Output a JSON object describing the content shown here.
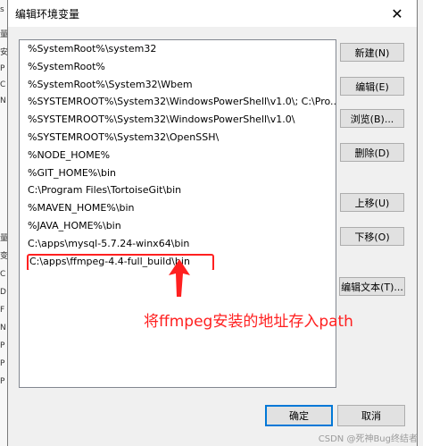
{
  "dialog": {
    "title": "编辑环境变量",
    "close_icon": "close-icon"
  },
  "path_list": {
    "items": [
      "%SystemRoot%\\system32",
      "%SystemRoot%",
      "%SystemRoot%\\System32\\Wbem",
      "%SYSTEMROOT%\\System32\\WindowsPowerShell\\v1.0\\;  C:\\Pro...",
      "%SYSTEMROOT%\\System32\\WindowsPowerShell\\v1.0\\",
      "%SYSTEMROOT%\\System32\\OpenSSH\\",
      "%NODE_HOME%",
      "%GIT_HOME%\\bin",
      "C:\\Program Files\\TortoiseGit\\bin",
      "%MAVEN_HOME%\\bin",
      "%JAVA_HOME%\\bin",
      "C:\\apps\\mysql-5.7.24-winx64\\bin",
      "C:\\apps\\ffmpeg-4.4-full_build\\bin"
    ],
    "selected_index": 12
  },
  "buttons": {
    "new": "新建(N)",
    "edit": "编辑(E)",
    "browse": "浏览(B)...",
    "delete": "删除(D)",
    "move_up": "上移(U)",
    "move_down": "下移(O)",
    "edit_text": "编辑文本(T)...",
    "ok": "确定",
    "cancel": "取消"
  },
  "annotation": {
    "text": "将ffmpeg安装的地址存入path",
    "color": "#ff2020"
  },
  "watermark": {
    "text": "CSDN @死神Bug终结者"
  },
  "background_window": {
    "fragments": [
      "s",
      "量",
      "安",
      "P",
      "C",
      "N",
      "量",
      "变",
      "C",
      "D",
      "F",
      "N",
      "P",
      "P",
      "P",
      "P"
    ]
  },
  "colors": {
    "accent": "#0078d7",
    "highlight_red": "#ff2020"
  }
}
